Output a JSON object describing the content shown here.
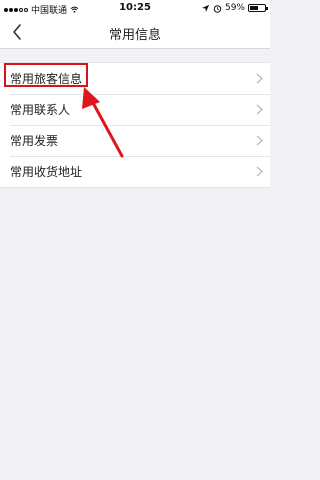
{
  "status_bar": {
    "carrier": "中国联通",
    "time": "10:25",
    "battery_percent": "59%",
    "battery_level": 0.59
  },
  "nav": {
    "title": "常用信息",
    "back_icon": "chevron-left-icon"
  },
  "list": {
    "items": [
      {
        "label": "常用旅客信息"
      },
      {
        "label": "常用联系人"
      },
      {
        "label": "常用发票"
      },
      {
        "label": "常用收货地址"
      }
    ],
    "chevron_icon": "chevron-right-icon"
  },
  "annotation": {
    "highlight_color": "#d7141a",
    "target": "常用旅客信息"
  }
}
